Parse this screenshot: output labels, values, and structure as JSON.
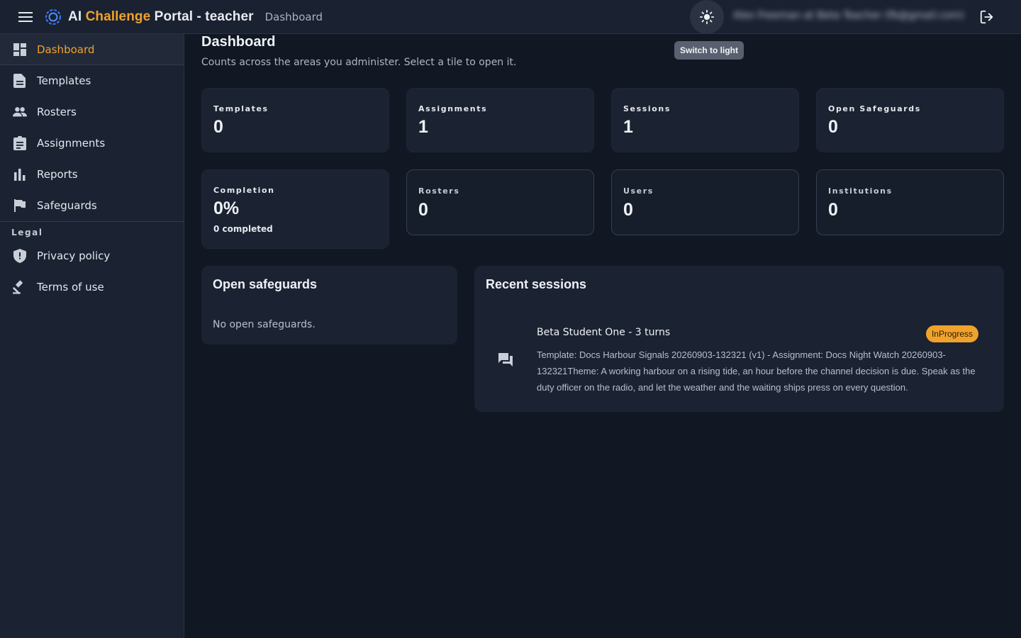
{
  "header": {
    "title_prefix": "AI ",
    "title_accent": "Challenge",
    "title_suffix": " Portal - teacher",
    "breadcrumb": "Dashboard",
    "theme_tooltip": "Switch to light",
    "user_email": "Alex Freeman at Beta Teacher (fb@gmail.com)"
  },
  "sidebar": {
    "items": [
      {
        "label": "Dashboard",
        "icon": "dashboard-icon",
        "active": true
      },
      {
        "label": "Templates",
        "icon": "document-icon"
      },
      {
        "label": "Rosters",
        "icon": "people-icon"
      },
      {
        "label": "Assignments",
        "icon": "clipboard-icon"
      },
      {
        "label": "Reports",
        "icon": "bar-chart-icon"
      },
      {
        "label": "Safeguards",
        "icon": "flag-icon"
      }
    ],
    "legal_label": "Legal",
    "legal_items": [
      {
        "label": "Privacy policy",
        "icon": "shield-icon"
      },
      {
        "label": "Terms of use",
        "icon": "gavel-icon"
      }
    ]
  },
  "main": {
    "title": "Dashboard",
    "subtitle": "Counts across the areas you administer. Select a tile to open it.",
    "tiles": [
      {
        "label": "Templates",
        "value": "0"
      },
      {
        "label": "Assignments",
        "value": "1"
      },
      {
        "label": "Sessions",
        "value": "1"
      },
      {
        "label": "Open Safeguards",
        "value": "0"
      },
      {
        "label": "Completion",
        "value": "0%",
        "sub": "0 completed"
      },
      {
        "label": "Rosters",
        "value": "0"
      },
      {
        "label": "Users",
        "value": "0"
      },
      {
        "label": "Institutions",
        "value": "0"
      }
    ],
    "safeguards_panel": {
      "title": "Open safeguards",
      "empty": "No open safeguards."
    },
    "sessions_panel": {
      "title": "Recent sessions",
      "sessions": [
        {
          "title": "Beta Student One - 3 turns",
          "status": "InProgress",
          "description": "Template: Docs Harbour Signals 20260903-132321 (v1) - Assignment: Docs Night Watch 20260903-132321Theme: A working harbour on a rising tide, an hour before the channel decision is due. Speak as the duty officer on the radio, and let the weather and the waiting ships press on every question."
        }
      ]
    }
  },
  "colors": {
    "accent": "#f0a22c",
    "background": "#111723",
    "surface": "#1b2231"
  }
}
